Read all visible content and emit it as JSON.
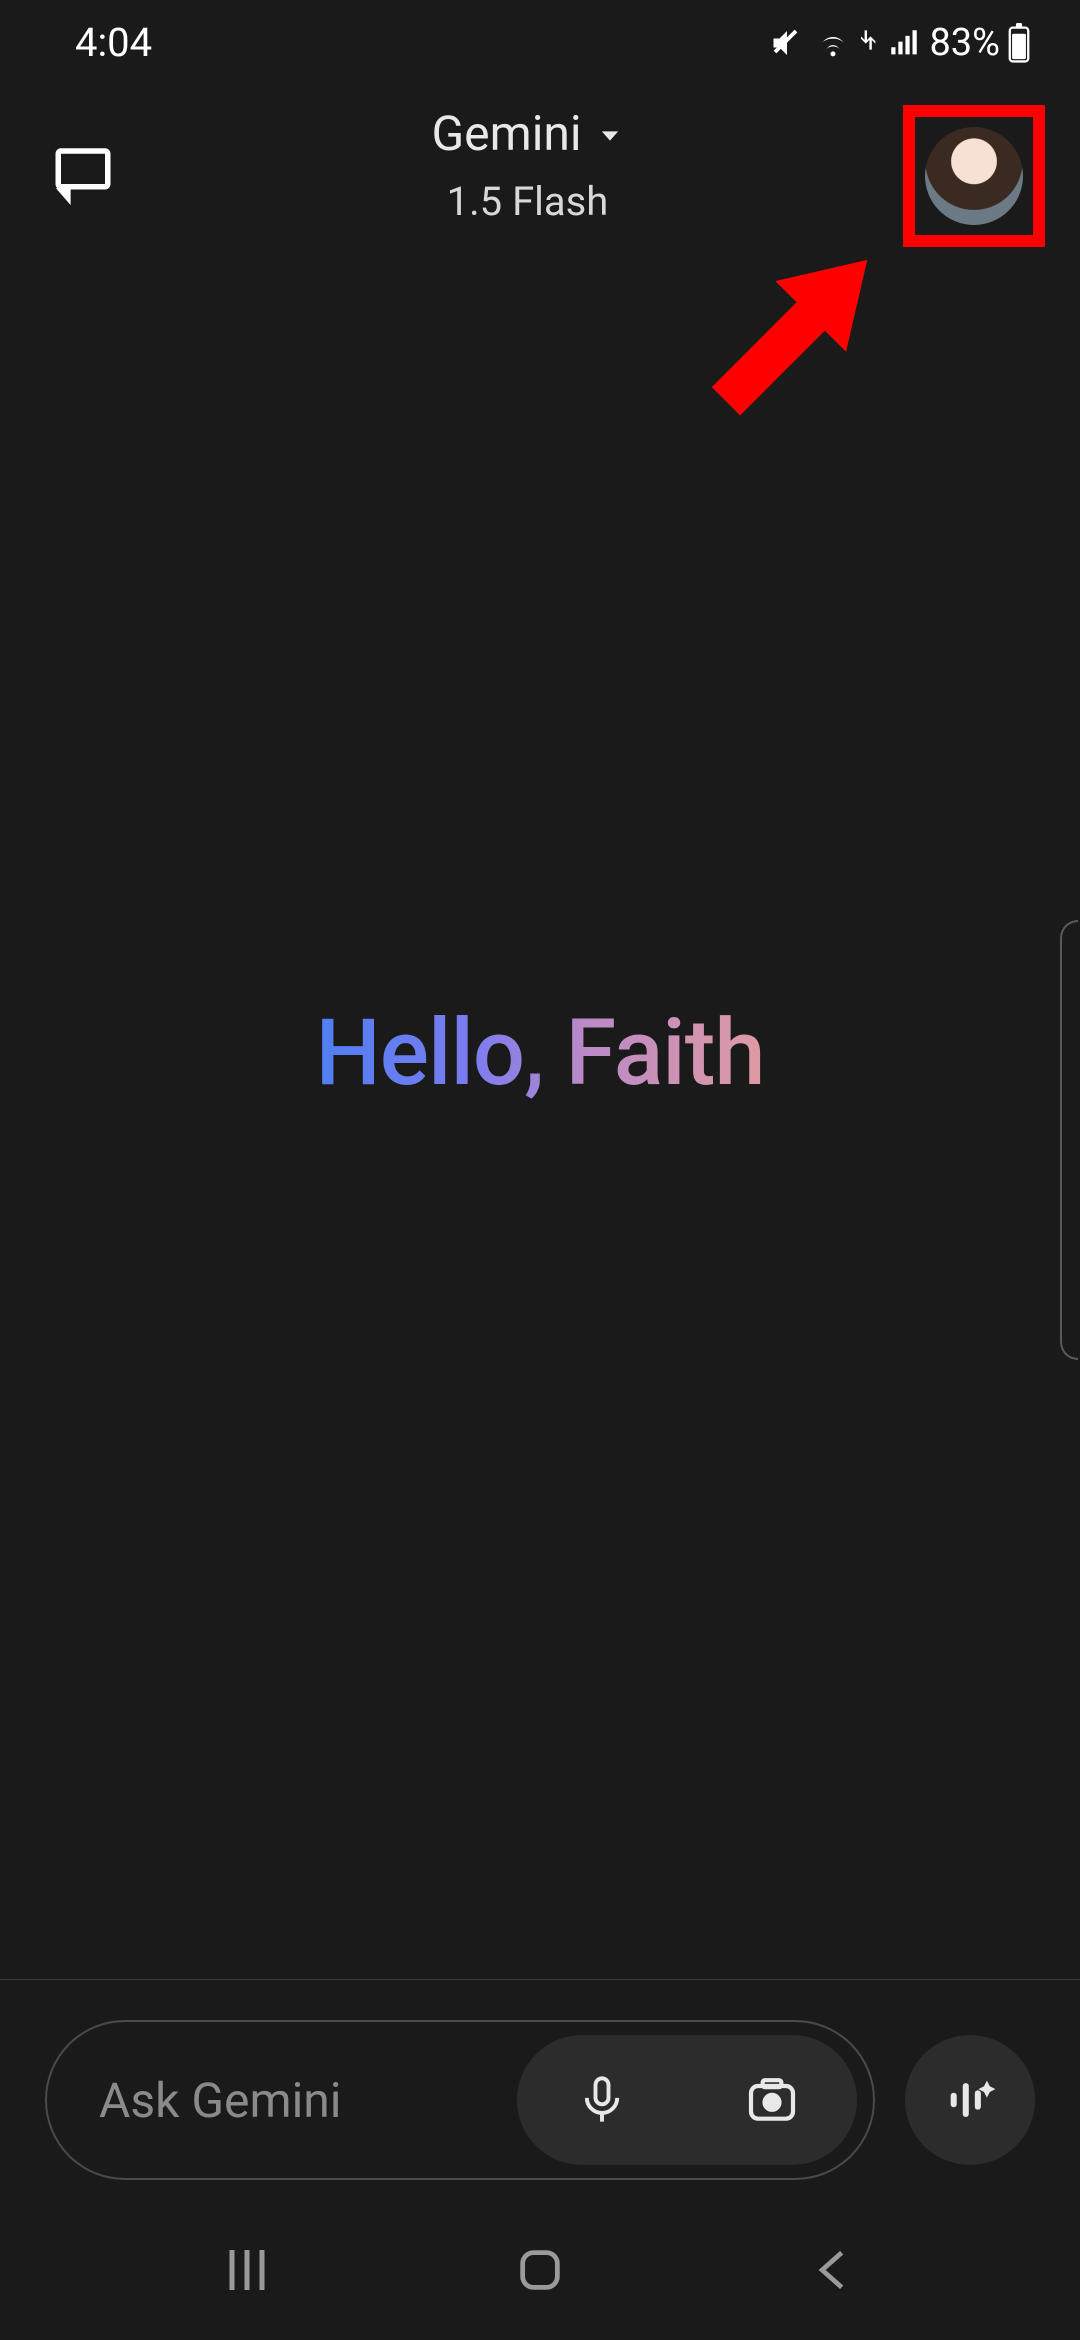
{
  "status_bar": {
    "time": "4:04",
    "volume_muted": true,
    "wifi": true,
    "signal": true,
    "battery_percent": "83%"
  },
  "header": {
    "model_name": "Gemini",
    "model_variant": "1.5 Flash"
  },
  "annotation": {
    "highlight_target": "profile-avatar",
    "arrow_color": "#ff0000"
  },
  "main": {
    "greeting": "Hello, Faith"
  },
  "input": {
    "placeholder": "Ask Gemini"
  }
}
